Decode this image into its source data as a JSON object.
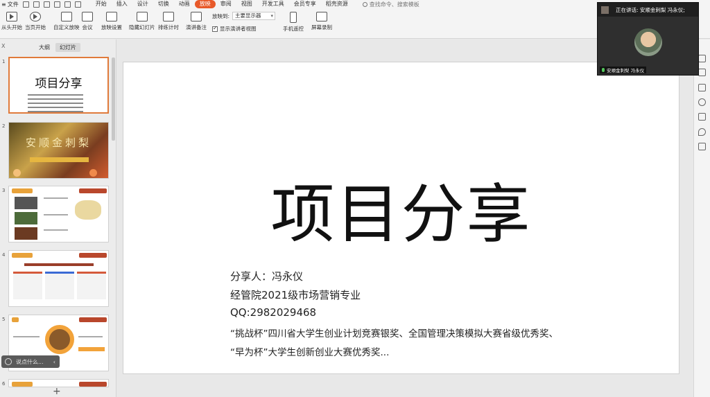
{
  "menubar": {
    "file_label": "文件",
    "tabs": [
      "开始",
      "插入",
      "设计",
      "切换",
      "动画",
      "放映",
      "审阅",
      "视图",
      "开发工具",
      "会员专享",
      "稻壳资源"
    ],
    "active_tab": "放映",
    "search_placeholder": "查找命令、搜索模板"
  },
  "toolbar": {
    "from_start": "从头开始",
    "from_current": "当页开始",
    "custom_show": "自定义放映",
    "meeting": "会议",
    "show_settings": "放映设置",
    "hide_slide": "隐藏幻灯片",
    "rehearse": "排练计时",
    "speaker_notes": "演讲备注",
    "show_on_label": "放映到:",
    "show_on_value": "主要显示器",
    "show_presenter_view": "显示演讲者视图",
    "phone_remote": "手机遥控",
    "screen_record": "屏幕录制"
  },
  "panel": {
    "close": "X",
    "tab_outline": "大纲",
    "tab_slides": "幻灯片",
    "add_slide": "+"
  },
  "thumbnails": {
    "t1_title": "项目分享",
    "t2_title": "安顺金刺梨",
    "numbers": [
      "1",
      "2",
      "3",
      "4",
      "5",
      "6"
    ]
  },
  "slide": {
    "title": "项目分享",
    "presenter": "分享人：冯永仪",
    "major": "经管院2021级市场营销专业",
    "qq": "QQ:2982029468",
    "award1": "“挑战杯”四川省大学生创业计划竞赛银奖、全国管理决策模拟大赛省级优秀奖、",
    "award2": "“早为杯”大学生创新创业大赛优秀奖..."
  },
  "comment": {
    "placeholder": "说点什么..."
  },
  "video": {
    "speaking": "正在讲话: 安顺金刺梨 冯永仪;",
    "name_tag": "安顺金刺梨 冯永仪"
  }
}
